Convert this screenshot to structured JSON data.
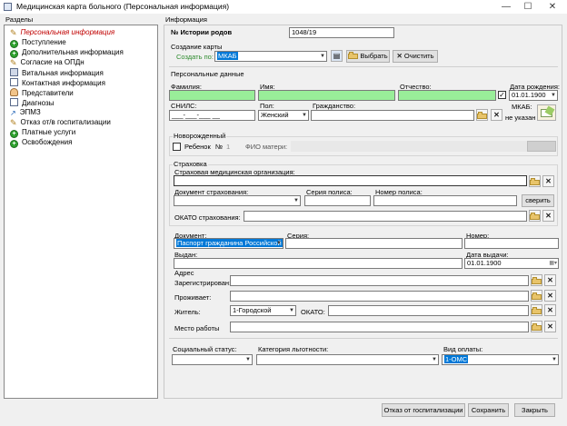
{
  "window": {
    "title": "Медицинская карта больного (Персональная информация)",
    "minimize": "—",
    "maximize": "☐",
    "close": "✕"
  },
  "sections": {
    "header": "Разделы",
    "items": [
      {
        "label": "Персональная информация",
        "icon": "pencil-icon",
        "active": true
      },
      {
        "label": "Поступление",
        "icon": "plus-icon"
      },
      {
        "label": "Дополнительная информация",
        "icon": "plus-icon"
      },
      {
        "label": "Согласие на ОПДн",
        "icon": "pencil-icon"
      },
      {
        "label": "Витальная информация",
        "icon": "clipboard-icon"
      },
      {
        "label": "Контактная информация",
        "icon": "document-icon"
      },
      {
        "label": "Представители",
        "icon": "person-icon"
      },
      {
        "label": "Диагнозы",
        "icon": "document-icon"
      },
      {
        "label": "ЭПМЗ",
        "icon": "arrow-icon"
      },
      {
        "label": "Отказ от/в госпитализации",
        "icon": "pencil-icon"
      },
      {
        "label": "Платные услуги",
        "icon": "plus-icon"
      },
      {
        "label": "Освобождения",
        "icon": "plus-icon"
      }
    ]
  },
  "info": {
    "header": "Информация",
    "history_label": "№ Истории родов",
    "history_value": "1048/19",
    "card_group": "Создание карты",
    "create_by_label": "Создать по:",
    "create_by_value": "МКАБ",
    "choose_btn": "Выбрать",
    "clear_btn": "Очистить",
    "personal_group": "Персональные данные",
    "surname_label": "Фамилия:",
    "name_label": "Имя:",
    "patronymic_label": "Отчество:",
    "birth_label": "Дата рождения:",
    "birth_value": "01.01.1900",
    "snils_label": "СНИЛС:",
    "snils_value": "___-___-___ __",
    "sex_label": "Пол:",
    "sex_value": "Женский",
    "citizenship_label": "Гражданство:",
    "mkab_label": "МКАБ:",
    "mkab_value": "не указан",
    "newborn_group": "Новорожденный",
    "child_label": "Ребенок",
    "child_no_label": "№",
    "child_no_value": "1",
    "mother_label": "ФИО матери:",
    "insurance_group": "Страховка",
    "insurer_label": "Страховая медицинская организация:",
    "ins_doc_label": "Документ страхования:",
    "policy_series_label": "Серия полиса:",
    "policy_number_label": "Номер полиса:",
    "verify_btn": "сверить",
    "okato_ins_label": "ОКАТО страхования:",
    "doc_label": "Документ:",
    "doc_value": "Паспорт гражданина Российской Федерации",
    "series_label": "Серия:",
    "number_label": "Номер:",
    "issued_label": "Выдан:",
    "issue_date_label": "Дата выдачи:",
    "issue_date_value": "01.01.1900",
    "address_group": "Адрес",
    "registered_label": "Зарегистрирован:",
    "lives_label": "Проживает:",
    "resident_label": "Житель:",
    "resident_value": "1-Городской",
    "okato_label": "ОКАТО:",
    "work_label": "Место работы",
    "social_label": "Социальный статус:",
    "benefit_label": "Категория льготности:",
    "payment_label": "Вид оплаты:",
    "payment_value": "1-ОМС"
  },
  "footer": {
    "refuse_btn": "Отказ от госпитализации",
    "save_btn": "Сохранить",
    "close_btn": "Закрыть"
  },
  "colors": {
    "required_field": "#99ee99",
    "selection": "#0078d7",
    "active_section": "#c00000"
  }
}
